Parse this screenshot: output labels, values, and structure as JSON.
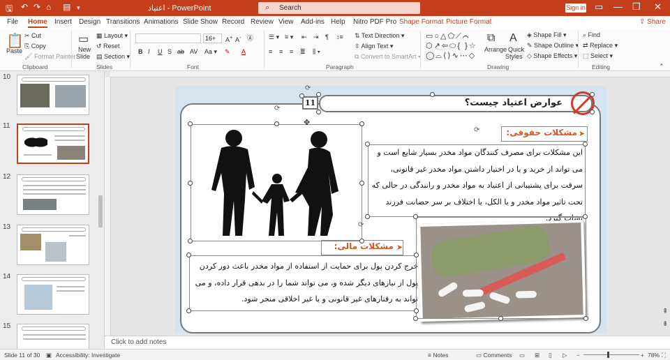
{
  "titlebar": {
    "doc_title": "اعتیاد  -  PowerPoint",
    "search_placeholder": "Search",
    "signin": "Sign in"
  },
  "tabs": [
    "File",
    "Home",
    "Insert",
    "Design",
    "Transitions",
    "Animations",
    "Slide Show",
    "Record",
    "Review",
    "View",
    "Add-ins",
    "Help",
    "Nitro PDF Pro",
    "Shape Format",
    "Picture Format"
  ],
  "share": "Share",
  "ribbon": {
    "clipboard": {
      "paste": "Paste",
      "cut": "Cut",
      "copy": "Copy",
      "format_painter": "Format Painter",
      "group": "Clipboard"
    },
    "slides": {
      "new_slide": "New",
      "new_slide2": "Slide",
      "layout": "Layout",
      "reset": "Reset",
      "section": "Section",
      "group": "Slides"
    },
    "font": {
      "name": "",
      "size": "16+",
      "group": "Font"
    },
    "paragraph": {
      "text_direction": "Text Direction",
      "align_text": "Align Text",
      "smartart": "Convert to SmartArt",
      "group": "Paragraph"
    },
    "drawing": {
      "arrange": "Arrange",
      "quick_styles": "Quick",
      "quick_styles2": "Styles",
      "shape_fill": "Shape Fill",
      "shape_outline": "Shape Outline",
      "shape_effects": "Shape Effects",
      "group": "Drawing"
    },
    "editing": {
      "find": "Find",
      "replace": "Replace",
      "select": "Select",
      "group": "Editing"
    }
  },
  "thumbnails": [
    "10",
    "11",
    "12",
    "13",
    "14",
    "15"
  ],
  "slide": {
    "number": "11",
    "title": "عوارض اعتیاد چیست؟",
    "legal_header": "مشکلات حقوقی:",
    "legal_body": "این مشکلات برای مصرف کنندگان مواد مخدر بسیار شایع است و می تواند از خرید و یا در اختیار داشتن مواد مخدر غیر قانونی، سرقت برای پشتیبانی از اعتیاد به مواد مخدر و رانندگی در حالی که تحت تاثیر مواد مخدر و یا الکل، یا اختلاف بر سر حضانت فرزند نشات گیرد.",
    "financial_header": "مشکلات مالی:",
    "financial_body": "خرج کردن پول برای حمایت از استفاده از مواد مخدر باعث دور کردن پول از نیازهای دیگر شده و، می تواند شما را در بدهی قرار داده، و می تواند به رفتارهای غیر قانونی و یا غیر اخلاقی منجر شود."
  },
  "notes_placeholder": "Click to add notes",
  "status": {
    "slide_info": "Slide 11 of 30",
    "accessibility": "Accessibility: Investigate",
    "notes": "Notes",
    "comments": "Comments",
    "zoom": "78%"
  }
}
